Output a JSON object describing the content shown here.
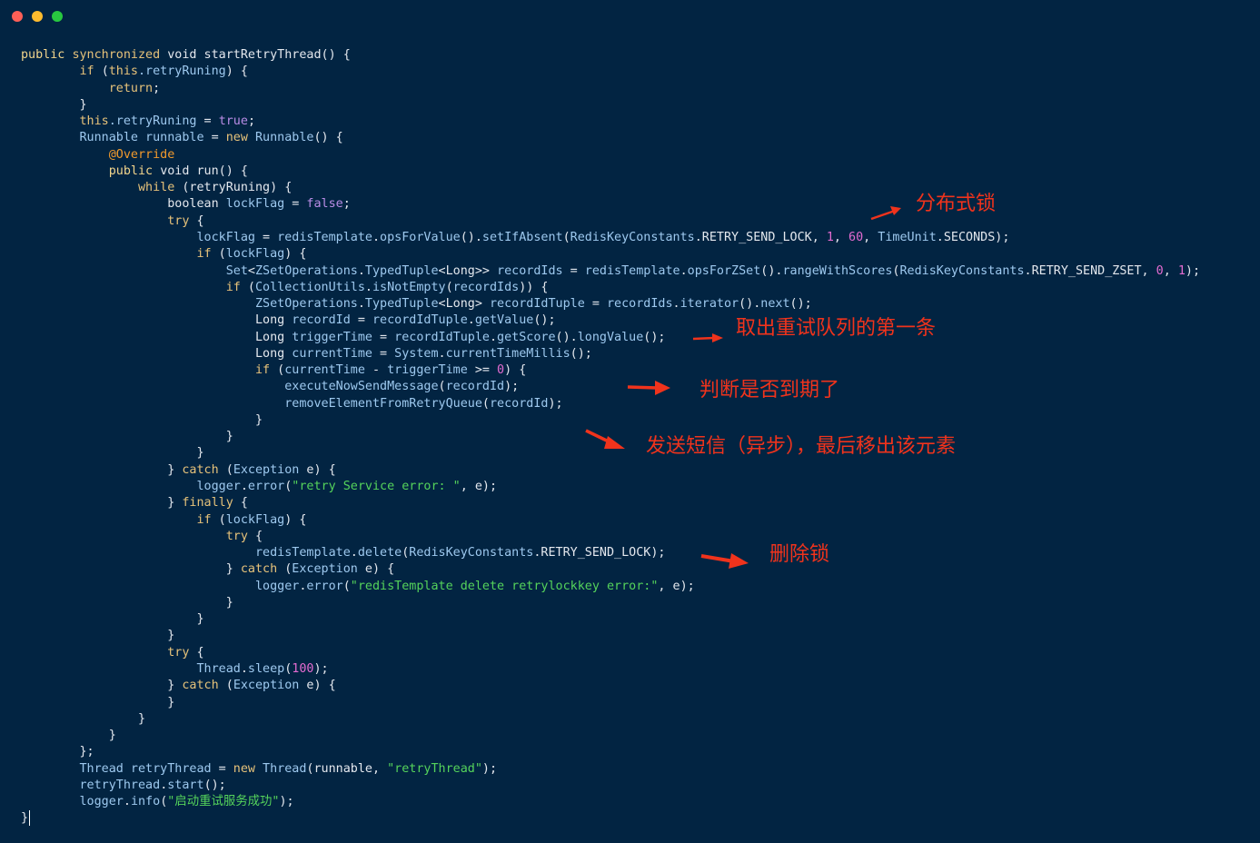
{
  "window": {
    "buttons": [
      "close",
      "minimize",
      "zoom"
    ]
  },
  "code": {
    "lines": [
      [
        {
          "t": "public ",
          "c": "kw2"
        },
        {
          "t": "synchronized ",
          "c": "kw"
        },
        {
          "t": "void startRetryThread() {",
          "c": "plain"
        }
      ],
      [
        {
          "t": "        if ",
          "c": "kw"
        },
        {
          "t": "(",
          "c": "plain"
        },
        {
          "t": "this",
          "c": "kw"
        },
        {
          "t": ".retryRuning",
          "c": "id"
        },
        {
          "t": ") {",
          "c": "plain"
        }
      ],
      [
        {
          "t": "            return",
          "c": "kw"
        },
        {
          "t": ";",
          "c": "plain"
        }
      ],
      [
        {
          "t": "        }",
          "c": "plain"
        }
      ],
      [
        {
          "t": "        this",
          "c": "kw"
        },
        {
          "t": ".retryRuning",
          "c": "id"
        },
        {
          "t": " = ",
          "c": "plain"
        },
        {
          "t": "true",
          "c": "bool"
        },
        {
          "t": ";",
          "c": "plain"
        }
      ],
      [
        {
          "t": "        Runnable runnable",
          "c": "type"
        },
        {
          "t": " = ",
          "c": "plain"
        },
        {
          "t": "new ",
          "c": "kw"
        },
        {
          "t": "Runnable",
          "c": "type"
        },
        {
          "t": "() {",
          "c": "plain"
        }
      ],
      [
        {
          "t": "            @Override",
          "c": "ann"
        }
      ],
      [
        {
          "t": "            public ",
          "c": "kw2"
        },
        {
          "t": "void run() {",
          "c": "plain"
        }
      ],
      [
        {
          "t": "                while ",
          "c": "kw"
        },
        {
          "t": "(retryRuning) {",
          "c": "plain"
        }
      ],
      [
        {
          "t": "                    boolean ",
          "c": "plain"
        },
        {
          "t": "lockFlag",
          "c": "id"
        },
        {
          "t": " = ",
          "c": "plain"
        },
        {
          "t": "false",
          "c": "bool"
        },
        {
          "t": ";",
          "c": "plain"
        }
      ],
      [
        {
          "t": "                    try ",
          "c": "kw"
        },
        {
          "t": "{",
          "c": "plain"
        }
      ],
      [
        {
          "t": "                        lockFlag",
          "c": "id"
        },
        {
          "t": " = ",
          "c": "plain"
        },
        {
          "t": "redisTemplate",
          "c": "id"
        },
        {
          "t": ".",
          "c": "plain"
        },
        {
          "t": "opsForValue",
          "c": "id"
        },
        {
          "t": "().",
          "c": "plain"
        },
        {
          "t": "setIfAbsent",
          "c": "id"
        },
        {
          "t": "(",
          "c": "plain"
        },
        {
          "t": "RedisKeyConstants",
          "c": "id"
        },
        {
          "t": ".RETRY_SEND_LOCK, ",
          "c": "plain"
        },
        {
          "t": "1",
          "c": "num"
        },
        {
          "t": ", ",
          "c": "plain"
        },
        {
          "t": "60",
          "c": "num"
        },
        {
          "t": ", ",
          "c": "plain"
        },
        {
          "t": "TimeUnit",
          "c": "id"
        },
        {
          "t": ".SECONDS);",
          "c": "plain"
        }
      ],
      [
        {
          "t": "                        if ",
          "c": "kw"
        },
        {
          "t": "(",
          "c": "plain"
        },
        {
          "t": "lockFlag",
          "c": "id"
        },
        {
          "t": ") {",
          "c": "plain"
        }
      ],
      [
        {
          "t": "                            Set",
          "c": "type"
        },
        {
          "t": "<",
          "c": "plain"
        },
        {
          "t": "ZSetOperations",
          "c": "id"
        },
        {
          "t": ".",
          "c": "plain"
        },
        {
          "t": "TypedTuple",
          "c": "id"
        },
        {
          "t": "<Long>> ",
          "c": "plain"
        },
        {
          "t": "recordIds",
          "c": "id"
        },
        {
          "t": " = ",
          "c": "plain"
        },
        {
          "t": "redisTemplate",
          "c": "id"
        },
        {
          "t": ".",
          "c": "plain"
        },
        {
          "t": "opsForZSet",
          "c": "id"
        },
        {
          "t": "().",
          "c": "plain"
        },
        {
          "t": "rangeWithScores",
          "c": "id"
        },
        {
          "t": "(",
          "c": "plain"
        },
        {
          "t": "RedisKeyConstants",
          "c": "id"
        },
        {
          "t": ".RETRY_SEND_ZSET, ",
          "c": "plain"
        },
        {
          "t": "0",
          "c": "num"
        },
        {
          "t": ", ",
          "c": "plain"
        },
        {
          "t": "1",
          "c": "num"
        },
        {
          "t": ");",
          "c": "plain"
        }
      ],
      [
        {
          "t": "                            if ",
          "c": "kw"
        },
        {
          "t": "(",
          "c": "plain"
        },
        {
          "t": "CollectionUtils",
          "c": "id"
        },
        {
          "t": ".",
          "c": "plain"
        },
        {
          "t": "isNotEmpty",
          "c": "id"
        },
        {
          "t": "(",
          "c": "plain"
        },
        {
          "t": "recordIds",
          "c": "id"
        },
        {
          "t": ")) {",
          "c": "plain"
        }
      ],
      [
        {
          "t": "                                ZSetOperations",
          "c": "id"
        },
        {
          "t": ".",
          "c": "plain"
        },
        {
          "t": "TypedTuple",
          "c": "id"
        },
        {
          "t": "<Long> ",
          "c": "plain"
        },
        {
          "t": "recordIdTuple",
          "c": "id"
        },
        {
          "t": " = ",
          "c": "plain"
        },
        {
          "t": "recordIds",
          "c": "id"
        },
        {
          "t": ".",
          "c": "plain"
        },
        {
          "t": "iterator",
          "c": "id"
        },
        {
          "t": "().",
          "c": "plain"
        },
        {
          "t": "next",
          "c": "id"
        },
        {
          "t": "();",
          "c": "plain"
        }
      ],
      [
        {
          "t": "                                Long ",
          "c": "plain"
        },
        {
          "t": "recordId",
          "c": "id"
        },
        {
          "t": " = ",
          "c": "plain"
        },
        {
          "t": "recordIdTuple",
          "c": "id"
        },
        {
          "t": ".",
          "c": "plain"
        },
        {
          "t": "getValue",
          "c": "id"
        },
        {
          "t": "();",
          "c": "plain"
        }
      ],
      [
        {
          "t": "                                Long ",
          "c": "plain"
        },
        {
          "t": "triggerTime",
          "c": "id"
        },
        {
          "t": " = ",
          "c": "plain"
        },
        {
          "t": "recordIdTuple",
          "c": "id"
        },
        {
          "t": ".",
          "c": "plain"
        },
        {
          "t": "getScore",
          "c": "id"
        },
        {
          "t": "().",
          "c": "plain"
        },
        {
          "t": "longValue",
          "c": "id"
        },
        {
          "t": "();",
          "c": "plain"
        }
      ],
      [
        {
          "t": "                                Long ",
          "c": "plain"
        },
        {
          "t": "currentTime",
          "c": "id"
        },
        {
          "t": " = ",
          "c": "plain"
        },
        {
          "t": "System",
          "c": "id"
        },
        {
          "t": ".",
          "c": "plain"
        },
        {
          "t": "currentTimeMillis",
          "c": "id"
        },
        {
          "t": "();",
          "c": "plain"
        }
      ],
      [
        {
          "t": "                                if ",
          "c": "kw"
        },
        {
          "t": "(",
          "c": "plain"
        },
        {
          "t": "currentTime",
          "c": "id"
        },
        {
          "t": " - ",
          "c": "plain"
        },
        {
          "t": "triggerTime",
          "c": "id"
        },
        {
          "t": " >= ",
          "c": "plain"
        },
        {
          "t": "0",
          "c": "num"
        },
        {
          "t": ") {",
          "c": "plain"
        }
      ],
      [
        {
          "t": "                                    executeNowSendMessage",
          "c": "id"
        },
        {
          "t": "(",
          "c": "plain"
        },
        {
          "t": "recordId",
          "c": "id"
        },
        {
          "t": ");",
          "c": "plain"
        }
      ],
      [
        {
          "t": "                                    removeElementFromRetryQueue",
          "c": "id"
        },
        {
          "t": "(",
          "c": "plain"
        },
        {
          "t": "recordId",
          "c": "id"
        },
        {
          "t": ");",
          "c": "plain"
        }
      ],
      [
        {
          "t": "                                }",
          "c": "plain"
        }
      ],
      [
        {
          "t": "                            }",
          "c": "plain"
        }
      ],
      [
        {
          "t": "                        }",
          "c": "plain"
        }
      ],
      [
        {
          "t": "                    } ",
          "c": "plain"
        },
        {
          "t": "catch ",
          "c": "kw"
        },
        {
          "t": "(",
          "c": "plain"
        },
        {
          "t": "Exception",
          "c": "id"
        },
        {
          "t": " e) {",
          "c": "plain"
        }
      ],
      [
        {
          "t": "                        logger",
          "c": "id"
        },
        {
          "t": ".",
          "c": "plain"
        },
        {
          "t": "error",
          "c": "id"
        },
        {
          "t": "(",
          "c": "plain"
        },
        {
          "t": "\"retry Service error: \"",
          "c": "str"
        },
        {
          "t": ", e);",
          "c": "plain"
        }
      ],
      [
        {
          "t": "                    } ",
          "c": "plain"
        },
        {
          "t": "finally ",
          "c": "kw"
        },
        {
          "t": "{",
          "c": "plain"
        }
      ],
      [
        {
          "t": "                        if ",
          "c": "kw"
        },
        {
          "t": "(",
          "c": "plain"
        },
        {
          "t": "lockFlag",
          "c": "id"
        },
        {
          "t": ") {",
          "c": "plain"
        }
      ],
      [
        {
          "t": "                            try ",
          "c": "kw"
        },
        {
          "t": "{",
          "c": "plain"
        }
      ],
      [
        {
          "t": "                                redisTemplate",
          "c": "id"
        },
        {
          "t": ".",
          "c": "plain"
        },
        {
          "t": "delete",
          "c": "id"
        },
        {
          "t": "(",
          "c": "plain"
        },
        {
          "t": "RedisKeyConstants",
          "c": "id"
        },
        {
          "t": ".RETRY_SEND_LOCK);",
          "c": "plain"
        }
      ],
      [
        {
          "t": "                            } ",
          "c": "plain"
        },
        {
          "t": "catch ",
          "c": "kw"
        },
        {
          "t": "(",
          "c": "plain"
        },
        {
          "t": "Exception",
          "c": "id"
        },
        {
          "t": " e) {",
          "c": "plain"
        }
      ],
      [
        {
          "t": "                                logger",
          "c": "id"
        },
        {
          "t": ".",
          "c": "plain"
        },
        {
          "t": "error",
          "c": "id"
        },
        {
          "t": "(",
          "c": "plain"
        },
        {
          "t": "\"redisTemplate delete retrylockkey error:\"",
          "c": "str"
        },
        {
          "t": ", e);",
          "c": "plain"
        }
      ],
      [
        {
          "t": "                            }",
          "c": "plain"
        }
      ],
      [
        {
          "t": "                        }",
          "c": "plain"
        }
      ],
      [
        {
          "t": "                    }",
          "c": "plain"
        }
      ],
      [
        {
          "t": "                    try ",
          "c": "kw"
        },
        {
          "t": "{",
          "c": "plain"
        }
      ],
      [
        {
          "t": "                        Thread",
          "c": "id"
        },
        {
          "t": ".",
          "c": "plain"
        },
        {
          "t": "sleep",
          "c": "id"
        },
        {
          "t": "(",
          "c": "plain"
        },
        {
          "t": "100",
          "c": "num"
        },
        {
          "t": ");",
          "c": "plain"
        }
      ],
      [
        {
          "t": "                    } ",
          "c": "plain"
        },
        {
          "t": "catch ",
          "c": "kw"
        },
        {
          "t": "(",
          "c": "plain"
        },
        {
          "t": "Exception",
          "c": "id"
        },
        {
          "t": " e) {",
          "c": "plain"
        }
      ],
      [
        {
          "t": "                    }",
          "c": "plain"
        }
      ],
      [
        {
          "t": "                }",
          "c": "plain"
        }
      ],
      [
        {
          "t": "            }",
          "c": "plain"
        }
      ],
      [
        {
          "t": "        };",
          "c": "plain"
        }
      ],
      [
        {
          "t": "        Thread retryThread",
          "c": "type"
        },
        {
          "t": " = ",
          "c": "plain"
        },
        {
          "t": "new ",
          "c": "kw"
        },
        {
          "t": "Thread",
          "c": "type"
        },
        {
          "t": "(runnable, ",
          "c": "plain"
        },
        {
          "t": "\"retryThread\"",
          "c": "str"
        },
        {
          "t": ");",
          "c": "plain"
        }
      ],
      [
        {
          "t": "        retryThread",
          "c": "id"
        },
        {
          "t": ".",
          "c": "plain"
        },
        {
          "t": "start",
          "c": "id"
        },
        {
          "t": "();",
          "c": "plain"
        }
      ],
      [
        {
          "t": "        logger",
          "c": "id"
        },
        {
          "t": ".",
          "c": "plain"
        },
        {
          "t": "info",
          "c": "id"
        },
        {
          "t": "(",
          "c": "plain"
        },
        {
          "t": "\"启动重试服务成功\"",
          "c": "str"
        },
        {
          "t": ");",
          "c": "plain"
        }
      ],
      [
        {
          "t": "}",
          "c": "plain"
        }
      ]
    ]
  },
  "annotations": {
    "distributed_lock": "分布式锁",
    "take_first": "取出重试队列的第一条",
    "check_expired": "判断是否到期了",
    "send_sms": "发送短信（异步），最后移出该元素",
    "delete_lock": "删除锁"
  },
  "colors": {
    "background": "#022442",
    "annotation": "#f0331c",
    "keyword": "#e6c27a",
    "string": "#55d35b",
    "number": "#e36bd0",
    "boolean": "#b98ce6",
    "annotation_token": "#f29a2c"
  }
}
